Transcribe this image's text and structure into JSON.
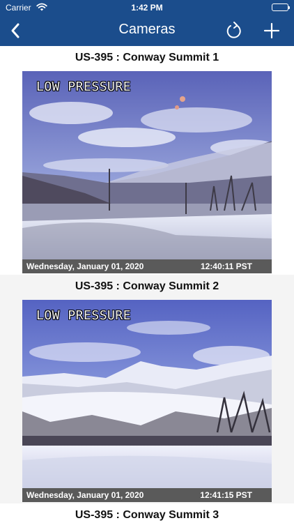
{
  "status_bar": {
    "carrier": "Carrier",
    "time": "1:42 PM",
    "wifi_icon": "wifi-icon",
    "battery_icon": "battery-icon"
  },
  "nav": {
    "title": "Cameras",
    "back_icon": "back-chevron-icon",
    "refresh_icon": "refresh-icon",
    "add_icon": "add-icon"
  },
  "cameras": [
    {
      "title": "US-395 : Conway Summit 1",
      "overlay_label": "LOW PRESSURE",
      "date": "Wednesday, January 01, 2020",
      "time": "12:40:11 PST"
    },
    {
      "title": "US-395 : Conway Summit 2",
      "overlay_label": "LOW PRESSURE",
      "date": "Wednesday, January 01, 2020",
      "time": "12:41:15 PST"
    },
    {
      "title": "US-395 : Conway Summit 3"
    }
  ],
  "colors": {
    "nav_background": "#1b4d8c",
    "alt_row_background": "#f4f4f4"
  }
}
